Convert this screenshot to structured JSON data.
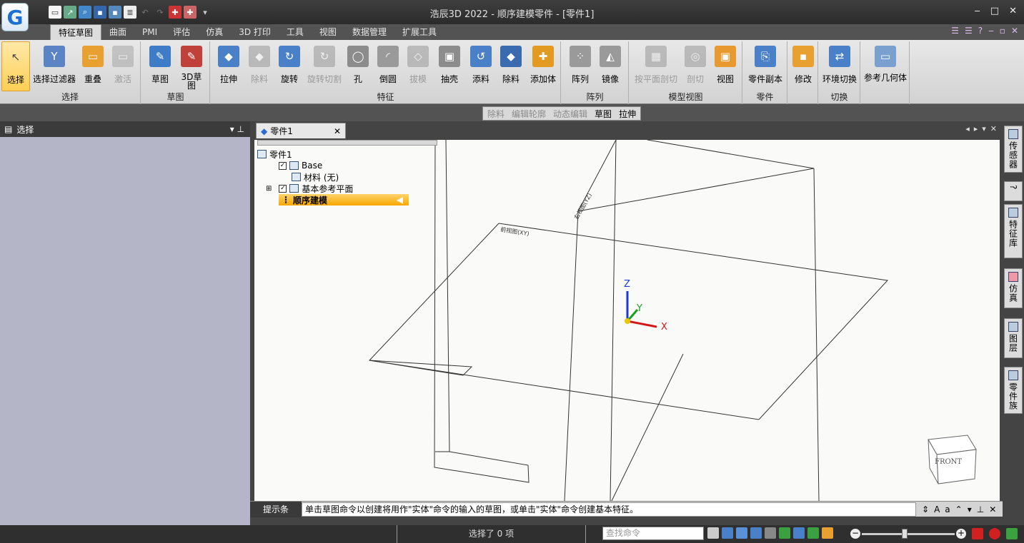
{
  "window": {
    "title": "浩辰3D 2022 - 顺序建模零件 - [零件1]",
    "minimize": "‒",
    "restore": "□",
    "close": "✕"
  },
  "tabs": [
    "特征草图",
    "曲面",
    "PMI",
    "评估",
    "仿真",
    "3D 打印",
    "工具",
    "视图",
    "数据管理",
    "扩展工具"
  ],
  "groups": {
    "select": {
      "label": "选择",
      "buttons": [
        "选择",
        "选择过滤器",
        "重叠",
        "激活"
      ]
    },
    "sketch": {
      "label": "草图",
      "buttons": [
        "草图",
        "3D草图"
      ]
    },
    "feature": {
      "label": "特征",
      "buttons": [
        "拉伸",
        "除料",
        "旋转",
        "旋转切割",
        "孔",
        "倒圆",
        "拔模",
        "抽壳",
        "添料",
        "除料",
        "添加体"
      ]
    },
    "pattern": {
      "label": "阵列",
      "buttons": [
        "阵列",
        "镜像"
      ]
    },
    "modelview": {
      "label": "模型视图",
      "buttons": [
        "按平面剖切",
        "剖切",
        "视图"
      ]
    },
    "part": {
      "label": "零件",
      "buttons": [
        "零件副本"
      ]
    },
    "modify": {
      "label": "",
      "buttons": [
        "修改"
      ]
    },
    "switch": {
      "label": "切换",
      "buttons": [
        "环境切换"
      ]
    },
    "refgeom": {
      "label": "",
      "buttons": [
        "参考几何体"
      ]
    }
  },
  "cmdbar": {
    "items": [
      "除料",
      "编辑轮廓",
      "动态编辑",
      "草图",
      "拉伸"
    ]
  },
  "left_panel": {
    "title": "选择"
  },
  "doc_tab": {
    "label": "零件1"
  },
  "tree": {
    "root": "零件1",
    "base": "Base",
    "material": "材料 (无)",
    "ref_planes": "基本参考平面",
    "seq": "顺序建模"
  },
  "viewport": {
    "plane_xy": "前视图(XY)",
    "plane_yz": "右视图(YZ)",
    "axis_x": "X",
    "axis_y": "Y",
    "axis_z": "Z",
    "viewcube": "FRONT"
  },
  "hint": {
    "label": "提示条",
    "text": "单击草图命令以创建将用作\"实体\"命令的输入的草图，或单击\"实体\"命令创建基本特征。"
  },
  "right_tabs": [
    "传感器",
    "?",
    "特征库",
    "仿真",
    "图层",
    "零件族"
  ],
  "status": {
    "selected": "选择了 0 项",
    "find_placeholder": "查找命令"
  }
}
